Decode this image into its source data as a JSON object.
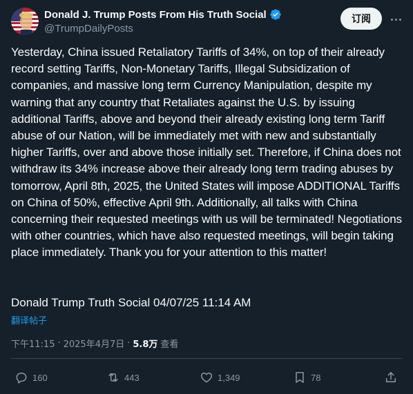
{
  "author": {
    "name": "Donald J. Trump Posts From His Truth Social",
    "handle": "@TrumpDailyPosts",
    "verified": true,
    "accent_color": "#1d9bf0"
  },
  "header": {
    "follow_label": "订阅",
    "more_icon": "more-horizontal-icon"
  },
  "post": {
    "paragraph": "Yesterday, China issued Retaliatory Tariffs of 34%, on top of their already record setting Tariffs, Non-Monetary Tariffs, Illegal Subsidization of companies, and massive long term Currency Manipulation, despite my warning that any country that Retaliates against the U.S. by issuing additional Tariffs, above and beyond their already existing long term Tariff abuse of our Nation, will be immediately met with new and substantially higher Tariffs, over and above those initially set. Therefore, if China does not withdraw its 34% increase above their already long term trading abuses by tomorrow, April 8th, 2025, the United States will impose ADDITIONAL Tariffs on China of 50%, effective April 9th. Additionally, all talks with China concerning their requested meetings with us will be terminated! Negotiations with other countries, which have also requested meetings, will begin taking place immediately. Thank you for your attention to this matter!",
    "signature": "Donald Trump Truth Social 04/07/25 11:14 AM",
    "translate_label": "翻译帖子"
  },
  "meta": {
    "time": "下午11:15",
    "separator": "·",
    "date": "2025年4月7日",
    "views_count": "5.8万",
    "views_label": "查看"
  },
  "actions": {
    "replies": "160",
    "reposts": "443",
    "likes": "1,349",
    "bookmarks": "78"
  }
}
